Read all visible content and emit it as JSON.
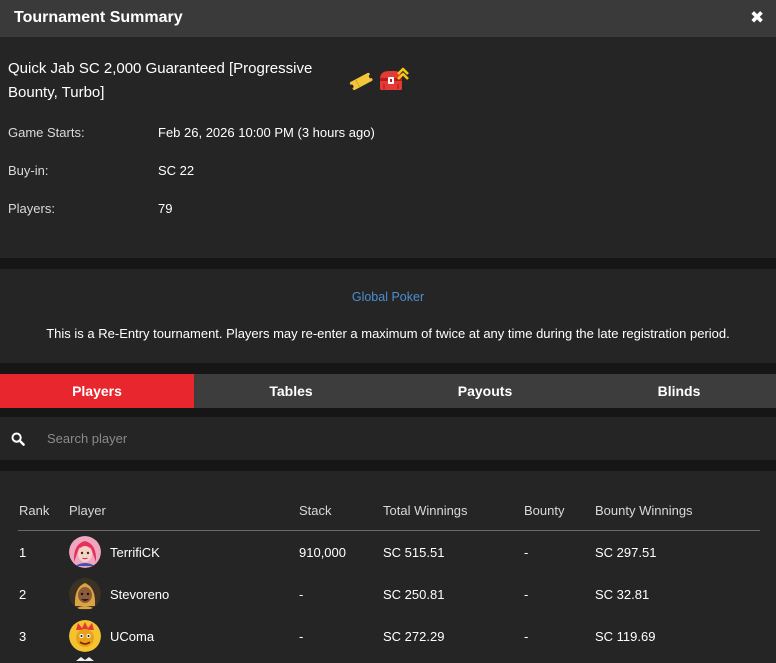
{
  "window": {
    "title": "Tournament Summary",
    "close_symbol": "✖"
  },
  "tournament": {
    "name": "Quick Jab SC 2,000 Guaranteed [Progressive Bounty, Turbo]",
    "icons": [
      "ticket-icon",
      "progressive-bounty-chest-icon"
    ],
    "rows": [
      {
        "label": "Game Starts:",
        "value": "Feb 26, 2026 10:00 PM (3 hours ago)"
      },
      {
        "label": "Buy-in:",
        "value": "SC 22"
      },
      {
        "label": "Players:",
        "value": "79"
      }
    ]
  },
  "notice": {
    "network": "Global Poker",
    "text": "This is a Re-Entry tournament. Players may re-enter a maximum of twice at any time during the late registration period."
  },
  "tabs": [
    {
      "label": "Players",
      "active": true
    },
    {
      "label": "Tables",
      "active": false
    },
    {
      "label": "Payouts",
      "active": false
    },
    {
      "label": "Blinds",
      "active": false
    }
  ],
  "search": {
    "placeholder": "Search player",
    "value": ""
  },
  "players_table": {
    "columns": [
      "Rank",
      "Player",
      "Stack",
      "Total Winnings",
      "Bounty",
      "Bounty Winnings"
    ],
    "rows": [
      {
        "rank": "1",
        "player": "TerrifiCK",
        "stack": "910,000",
        "total_winnings": "SC 515.51",
        "bounty": "-",
        "bounty_winnings": "SC 297.51"
      },
      {
        "rank": "2",
        "player": "Stevoreno",
        "stack": "-",
        "total_winnings": "SC 250.81",
        "bounty": "-",
        "bounty_winnings": "SC 32.81"
      },
      {
        "rank": "3",
        "player": "UComa",
        "stack": "-",
        "total_winnings": "SC 272.29",
        "bounty": "-",
        "bounty_winnings": "SC 119.69"
      }
    ]
  },
  "colors": {
    "accent": "#e8262d",
    "link": "#4b8fd1",
    "header_bg": "#3a3a3a",
    "panel_bg": "#252525",
    "page_bg": "#161616",
    "tab_bg": "#3d3d3d"
  }
}
